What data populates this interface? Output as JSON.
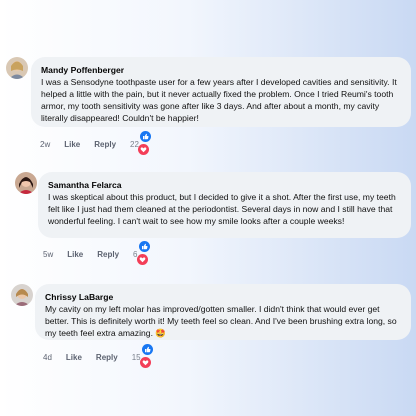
{
  "comments": [
    {
      "author": "Mandy Poffenberger",
      "text": "I was a Sensodyne toothpaste user for a few years after I developed cavities and sensitivity. It helped a little with the pain, but it never actually fixed the problem. Once I tried Reumi's tooth armor, my tooth sensitivity was gone after like 3 days. And after about a month, my cavity literally disappeared! Couldn't be happier!",
      "age": "2w",
      "like_label": "Like",
      "reply_label": "Reply",
      "reactions": "22"
    },
    {
      "author": "Samantha Felarca",
      "text": "I was skeptical about this product, but I decided to give it a shot. After the first use, my teeth felt like I just had them cleaned at the periodontist. Several days in now and I still have that wonderful feeling. I can't wait to see how my smile looks after a couple weeks!",
      "age": "5w",
      "like_label": "Like",
      "reply_label": "Reply",
      "reactions": "6"
    },
    {
      "author": "Chrissy LaBarge",
      "text": "My cavity on my left molar has improved/gotten smaller. I didn't think that would ever get better. This is definitely worth it! My teeth feel so clean. And I've been brushing extra long, so my teeth feel extra amazing. 🤩",
      "age": "4d",
      "like_label": "Like",
      "reply_label": "Reply",
      "reactions": "15"
    }
  ],
  "colors": {
    "like_blue": "#1877f2",
    "love_red": "#f33e58",
    "bubble": "#eff2f5"
  },
  "icons": [
    "like-reaction-icon",
    "love-reaction-icon"
  ]
}
